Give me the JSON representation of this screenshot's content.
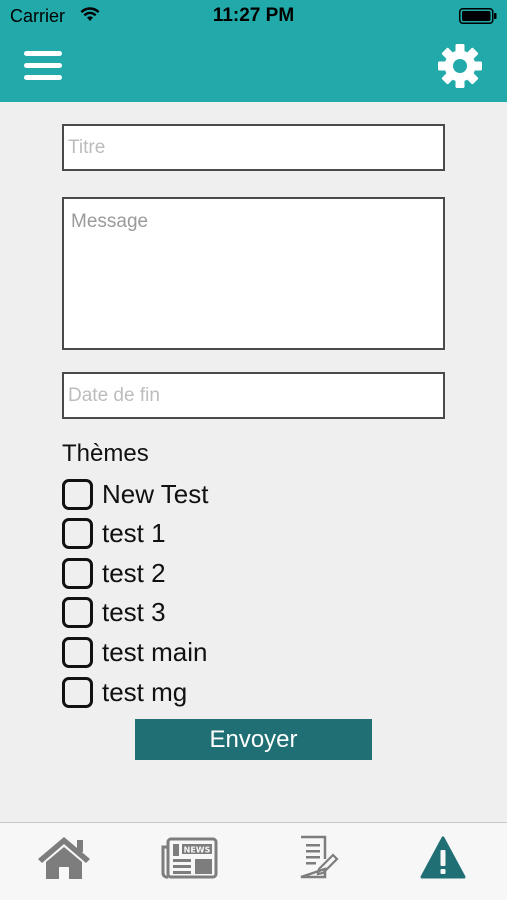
{
  "status_bar": {
    "carrier": "Carrier",
    "time": "11:27 PM"
  },
  "nav": {
    "menu_icon": "hamburger-menu-icon",
    "settings_icon": "gear-icon",
    "background_color": "#22a9a9"
  },
  "form": {
    "title_placeholder": "Titre",
    "title_value": "",
    "message_placeholder": "Message",
    "message_value": "",
    "end_date_placeholder": "Date de fin",
    "end_date_value": ""
  },
  "themes": {
    "heading": "Thèmes",
    "items": [
      {
        "label": "New Test",
        "checked": false
      },
      {
        "label": "test 1",
        "checked": false
      },
      {
        "label": "test 2",
        "checked": false
      },
      {
        "label": "test 3",
        "checked": false
      },
      {
        "label": "test main",
        "checked": false
      },
      {
        "label": "test mg",
        "checked": false
      }
    ]
  },
  "submit_label": "Envoyer",
  "submit_color": "#1f6f74",
  "tab_bar": {
    "active_tab": "alert",
    "tabs": [
      {
        "icon": "home-icon",
        "active": false
      },
      {
        "icon": "news-icon",
        "active": false
      },
      {
        "icon": "edit-document-icon",
        "active": false
      },
      {
        "icon": "alert-warning-icon",
        "active": true
      }
    ],
    "active_color": "#1f6f74",
    "inactive_color": "#7d7d7d"
  }
}
